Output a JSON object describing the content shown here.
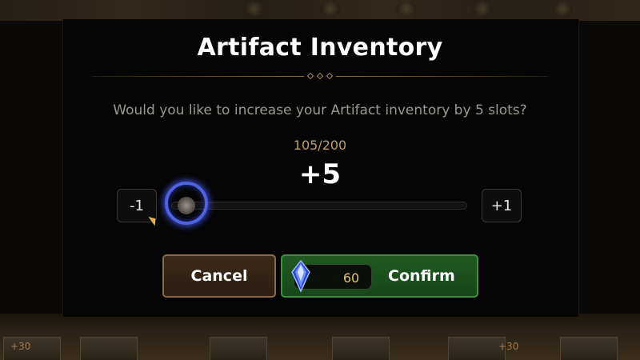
{
  "dialog": {
    "title": "Artifact Inventory",
    "question": "Would you like to increase your Artifact inventory by 5 slots?",
    "counter": "105/200",
    "amount": "+5"
  },
  "stepper": {
    "minus_label": "-1",
    "plus_label": "+1",
    "slider_fraction": 0.0
  },
  "actions": {
    "cancel_label": "Cancel",
    "confirm_label": "Confirm",
    "cost": "60",
    "cost_icon": "crystal-gem-icon"
  },
  "background": {
    "card_counts": [
      "+30",
      "+30"
    ]
  },
  "colors": {
    "confirm_green": "#1f5a21",
    "cancel_brown": "#3e2a18",
    "slider_glow": "#4f62e0",
    "counter_gold": "#c29a63"
  }
}
